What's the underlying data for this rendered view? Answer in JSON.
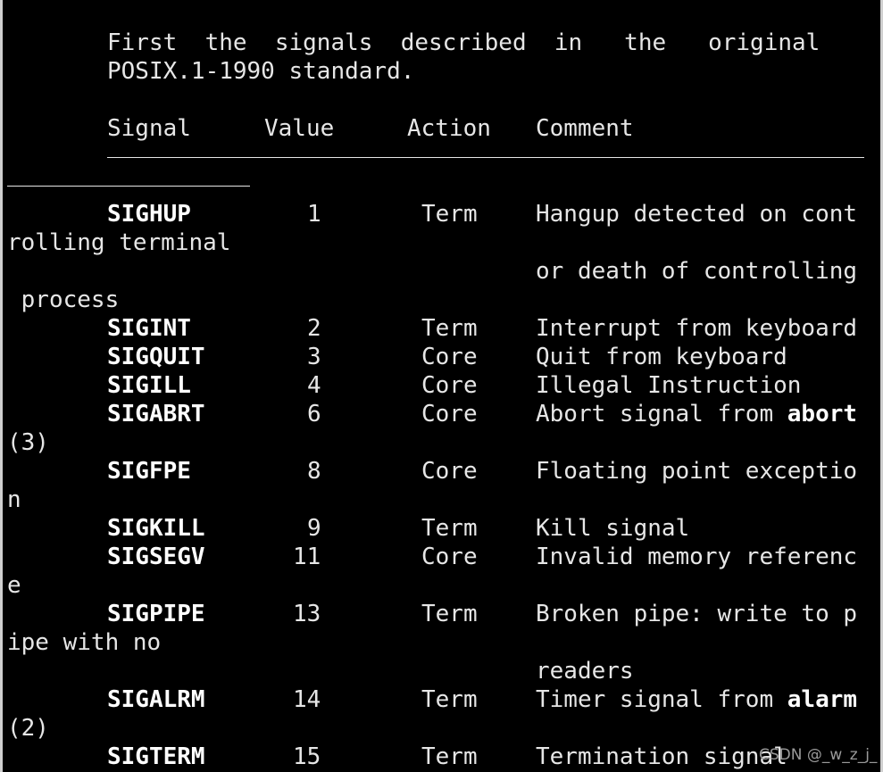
{
  "intro": {
    "line1": "First  the  signals  described  in   the   original",
    "line2": "POSIX.1-1990 standard."
  },
  "headers": {
    "signal": "Signal",
    "value": "Value",
    "action": "Action",
    "comment": "Comment"
  },
  "rows": [
    {
      "signal": "SIGHUP",
      "value": "1",
      "action": "Term",
      "comment": "Hangup detected on cont",
      "wraps": [
        "rolling terminal",
        "or death of controlling",
        " process"
      ]
    },
    {
      "signal": "SIGINT",
      "value": "2",
      "action": "Term",
      "comment": "Interrupt from keyboard"
    },
    {
      "signal": "SIGQUIT",
      "value": "3",
      "action": "Core",
      "comment": "Quit from keyboard"
    },
    {
      "signal": "SIGILL",
      "value": "4",
      "action": "Core",
      "comment": "Illegal Instruction"
    },
    {
      "signal": "SIGABRT",
      "value": "6",
      "action": "Core",
      "comment": "Abort signal from ",
      "comment_bold": "abort",
      "wraps": [
        "(3)"
      ]
    },
    {
      "signal": "SIGFPE",
      "value": "8",
      "action": "Core",
      "comment": "Floating point exceptio",
      "wraps": [
        "n"
      ]
    },
    {
      "signal": "SIGKILL",
      "value": "9",
      "action": "Term",
      "comment": "Kill signal"
    },
    {
      "signal": "SIGSEGV",
      "value": "11",
      "action": "Core",
      "comment": "Invalid memory referenc",
      "wraps": [
        "e"
      ]
    },
    {
      "signal": "SIGPIPE",
      "value": "13",
      "action": "Term",
      "comment": "Broken pipe: write to p",
      "wraps": [
        "ipe with no",
        "readers"
      ]
    },
    {
      "signal": "SIGALRM",
      "value": "14",
      "action": "Term",
      "comment": "Timer signal from ",
      "comment_bold": "alarm",
      "wraps": [
        "(2)"
      ]
    },
    {
      "signal": "SIGTERM",
      "value": "15",
      "action": "Term",
      "comment": "Termination signal"
    }
  ],
  "watermark": "CSDN @_w_z_j_"
}
